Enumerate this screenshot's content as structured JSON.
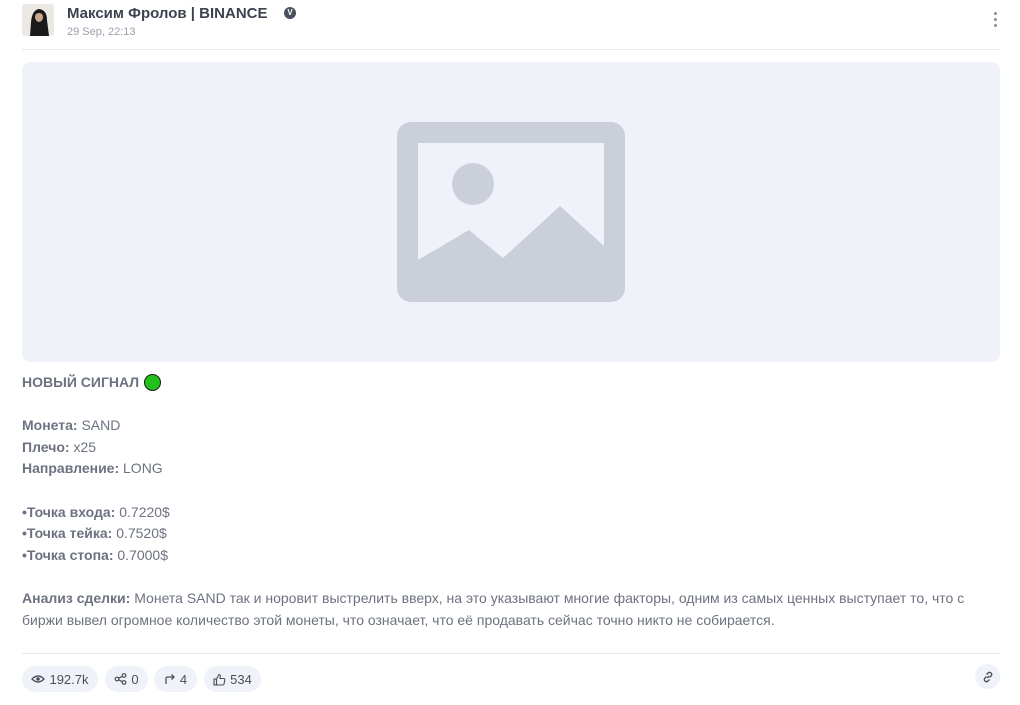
{
  "header": {
    "author": "Максим Фролов | BINANCE",
    "verified_mark": "V",
    "date": "29 Sep, 22:13",
    "menu_icon": "kebab-menu-icon"
  },
  "image": {
    "placeholder_icon": "image-placeholder-icon"
  },
  "post": {
    "title": "НОВЫЙ СИГНАЛ",
    "title_emoji": "green-circle",
    "coin_label": "Монета:",
    "coin_value": "SAND",
    "leverage_label": "Плечо:",
    "leverage_value": "x25",
    "direction_label": "Направление:",
    "direction_value": "LONG",
    "entry_label": "•Точка входа:",
    "entry_value": "0.7220$",
    "take_label": "•Точка тейка:",
    "take_value": "0.7520$",
    "stop_label": "•Точка стопа:",
    "stop_value": "0.7000$",
    "analysis_label": "Анализ сделки:",
    "analysis_text": "Монета SAND так и норовит выстрелить вверх, на это указывают многие факторы, одним из самых ценных выступает то, что с биржи вывел огромное количество этой монеты, что означает, что её продавать сейчас точно никто не собирается."
  },
  "footer": {
    "views": "192.7k",
    "shares": "0",
    "reposts": "4",
    "likes": "534"
  },
  "colors": {
    "accent_dot": "#22c01a",
    "chip_bg": "#eff2f8",
    "text": "#6c7280"
  }
}
